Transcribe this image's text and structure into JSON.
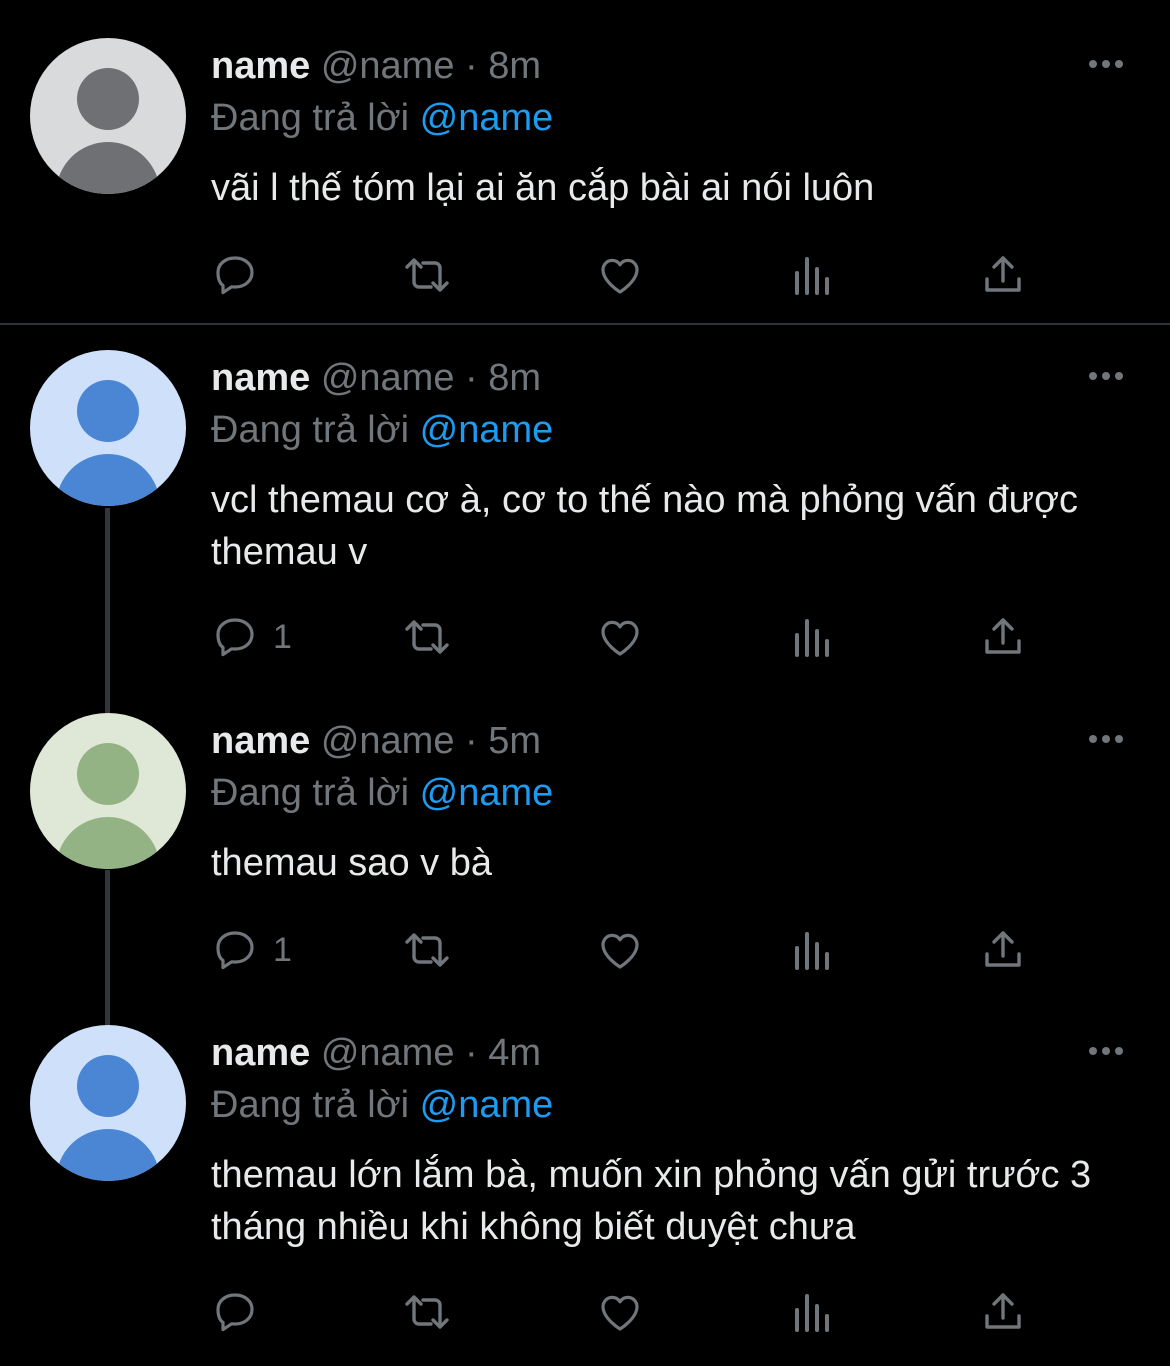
{
  "colors": {
    "background": "#000000",
    "text_primary": "#e7e9ea",
    "text_secondary": "#71767b",
    "accent": "#1d9bf0",
    "divider": "#2f3336"
  },
  "tweets": [
    {
      "name": "name",
      "handle": "@name",
      "separator": "·",
      "time": "8m",
      "reply_prefix": "Đang trả lời",
      "reply_to": "@name",
      "text": "vãi l thế tóm lại ai ăn cắp bài ai nói luôn",
      "reply_count": "",
      "avatar_style": "default-gray",
      "icons": [
        "reply-icon",
        "retweet-icon",
        "like-icon",
        "views-icon",
        "share-icon"
      ]
    },
    {
      "name": "name",
      "handle": "@name",
      "separator": "·",
      "time": "8m",
      "reply_prefix": "Đang trả lời",
      "reply_to": "@name",
      "text": "vcl themau cơ à, cơ to thế nào mà phỏng vấn được themau v",
      "reply_count": "1",
      "avatar_style": "blue",
      "icons": [
        "reply-icon",
        "retweet-icon",
        "like-icon",
        "views-icon",
        "share-icon"
      ]
    },
    {
      "name": "name",
      "handle": "@name",
      "separator": "·",
      "time": "5m",
      "reply_prefix": "Đang trả lời",
      "reply_to": "@name",
      "text": "themau sao v bà",
      "reply_count": "1",
      "avatar_style": "green",
      "icons": [
        "reply-icon",
        "retweet-icon",
        "like-icon",
        "views-icon",
        "share-icon"
      ]
    },
    {
      "name": "name",
      "handle": "@name",
      "separator": "·",
      "time": "4m",
      "reply_prefix": "Đang trả lời",
      "reply_to": "@name",
      "text": "themau lớn lắm bà, muốn xin phỏng vấn gửi trước 3 tháng nhiều khi không biết duyệt chưa",
      "reply_count": "",
      "avatar_style": "blue",
      "icons": [
        "reply-icon",
        "retweet-icon",
        "like-icon",
        "views-icon",
        "share-icon"
      ]
    }
  ]
}
